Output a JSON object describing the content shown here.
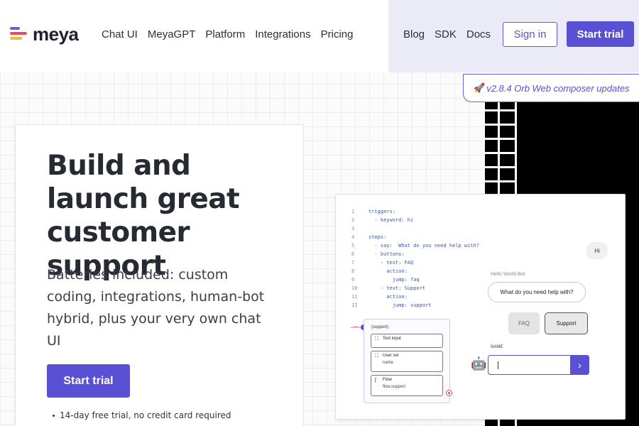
{
  "brand": {
    "name": "meya",
    "colors": {
      "accent": "#5a50d4",
      "red": "#e74b5c",
      "yellow": "#f5b83d"
    }
  },
  "nav": {
    "left": [
      "Chat UI",
      "MeyaGPT",
      "Platform",
      "Integrations",
      "Pricing"
    ],
    "right": [
      "Blog",
      "SDK",
      "Docs"
    ],
    "sign_in": "Sign in",
    "start_trial": "Start trial"
  },
  "release": {
    "icon": "rocket-icon",
    "text": "v2.8.4 Orb Web composer updates"
  },
  "hero": {
    "title": "Build and launch great customer support",
    "subtitle": "Batteries included: custom coding, integrations, human-bot hybrid, plus your very own chat UI",
    "cta": "Start trial",
    "note": "14-day free trial, no credit card required"
  },
  "demo": {
    "code": [
      {
        "n": "1",
        "t": "triggers:"
      },
      {
        "n": "2",
        "t": "  - keyword: hi"
      },
      {
        "n": "3",
        "t": ""
      },
      {
        "n": "4",
        "t": "steps:"
      },
      {
        "n": "5",
        "t": "  - say:  What do you need help with?"
      },
      {
        "n": "6",
        "t": "  - buttons:"
      },
      {
        "n": "7",
        "t": "    - text: FAQ"
      },
      {
        "n": "8",
        "t": "      action:"
      },
      {
        "n": "9",
        "t": "        jump: faq"
      },
      {
        "n": "10",
        "t": "    - text: Support"
      },
      {
        "n": "11",
        "t": "      action:"
      },
      {
        "n": "12",
        "t": "        jump: support"
      }
    ],
    "flow": {
      "title": "(support)",
      "nodes": [
        {
          "label": "Text input",
          "sub": "",
          "icon": "input-icon"
        },
        {
          "label": "User set",
          "sub": "name",
          "icon": "user-icon"
        },
        {
          "label": "Flow",
          "sub": "flow.support",
          "icon": "flow-icon"
        }
      ]
    },
    "chat": {
      "user_message": "Hi",
      "bot_name": "Hello World Bot",
      "bot_message": "What do you need help with?",
      "quick_replies": [
        "FAQ",
        "Support"
      ],
      "field_label": "NAME",
      "input_value": ""
    }
  }
}
